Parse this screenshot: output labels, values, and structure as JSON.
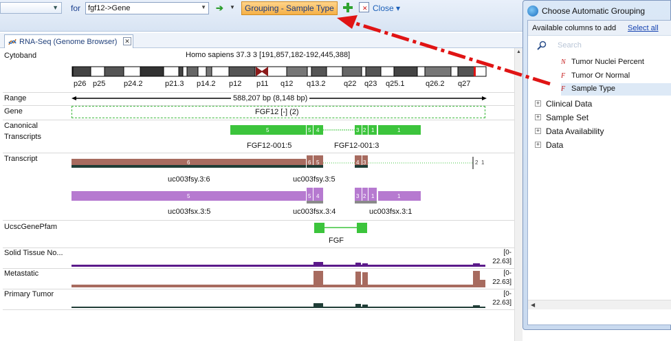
{
  "toolbar": {
    "for_label": "for",
    "search_value": "fgf12->Gene",
    "grouping_label": "Grouping - Sample Type",
    "close_label": "Close"
  },
  "tab": {
    "label": "RNA-Seq (Genome Browser)"
  },
  "browser": {
    "cytoband": {
      "label": "Cytoband",
      "title": "Homo sapiens 37.3 3 [191,857,182-192,445,388]",
      "bands": [
        "p26",
        "p25",
        "p24.2",
        "p21.3",
        "p14.2",
        "p12",
        "p11",
        "q12",
        "q13.2",
        "q22",
        "q23",
        "q25.1",
        "q26.2",
        "q27"
      ]
    },
    "range": {
      "label": "Range",
      "value": "588,207 bp (8,148 bp)"
    },
    "gene": {
      "label": "Gene",
      "value": "FGF12 [-] (2)"
    },
    "canonical": {
      "label": "Canonical Transcripts",
      "names": [
        "FGF12-001:5",
        "FGF12-001:3"
      ],
      "exon_numbers": [
        "5",
        "5",
        "4",
        "3",
        "2",
        "1",
        "1"
      ]
    },
    "transcript": {
      "label": "Transcript",
      "names": [
        "uc003fsy.3:6",
        "uc003fsy.3:5",
        "uc003fsx.3:5",
        "uc003fsx.3:4",
        "uc003fsx.3:1"
      ],
      "row1_exons": [
        "6",
        "6",
        "5",
        "4",
        "3",
        "2",
        "1"
      ],
      "row2_exons": [
        "5",
        "5",
        "4",
        "3",
        "2",
        "1",
        "1"
      ]
    },
    "pfam": {
      "label": "UcscGenePfam",
      "name": "FGF"
    },
    "tracks": [
      {
        "label": "Solid Tissue No...",
        "scale_top": "[0-",
        "scale_bot": "22.63]",
        "color": "#5b1a8a"
      },
      {
        "label": "Metastatic",
        "scale_top": "[0-",
        "scale_bot": "22.63]",
        "color": "#a76b5f"
      },
      {
        "label": "Primary Tumor",
        "scale_top": "[0-",
        "scale_bot": "22.63]",
        "color": "#1f3d36"
      }
    ]
  },
  "dialog": {
    "title": "Choose Automatic Grouping",
    "available_label": "Available columns to add",
    "select_all": "Select all",
    "search_placeholder": "Search",
    "leaves": [
      {
        "icon": "N",
        "label": "Tumor Nuclei Percent"
      },
      {
        "icon": "F",
        "label": "Tumor Or Normal"
      },
      {
        "icon": "F",
        "label": "Sample Type"
      }
    ],
    "groups": [
      "Clinical Data",
      "Sample Set",
      "Data Availability",
      "Data"
    ]
  },
  "colors": {
    "accent": "#f5b047",
    "exon_green": "#3cc43c",
    "transcript_brown": "#a76b5f",
    "transcript_purple": "#b67ad0",
    "arrow_red": "#e01414"
  }
}
